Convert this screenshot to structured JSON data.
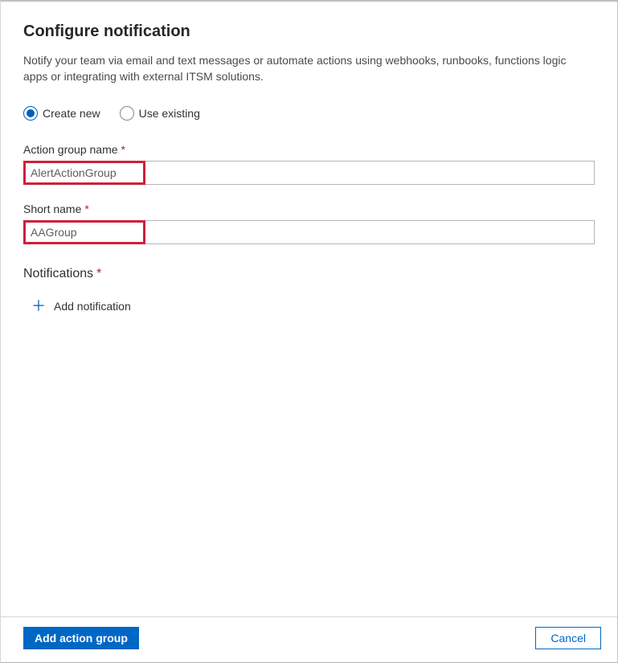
{
  "title": "Configure notification",
  "description": "Notify your team via email and text messages or automate actions using webhooks, runbooks, functions logic apps or integrating with external ITSM solutions.",
  "mode": {
    "create_new_label": "Create new",
    "use_existing_label": "Use existing",
    "selected": "create_new"
  },
  "fields": {
    "action_group_name": {
      "label": "Action group name",
      "required": true,
      "value": "AlertActionGroup"
    },
    "short_name": {
      "label": "Short name",
      "required": true,
      "value": "AAGroup"
    }
  },
  "notifications": {
    "section_label": "Notifications",
    "required": true,
    "add_label": "Add notification"
  },
  "footer": {
    "primary_label": "Add action group",
    "cancel_label": "Cancel"
  },
  "required_marker": "*"
}
